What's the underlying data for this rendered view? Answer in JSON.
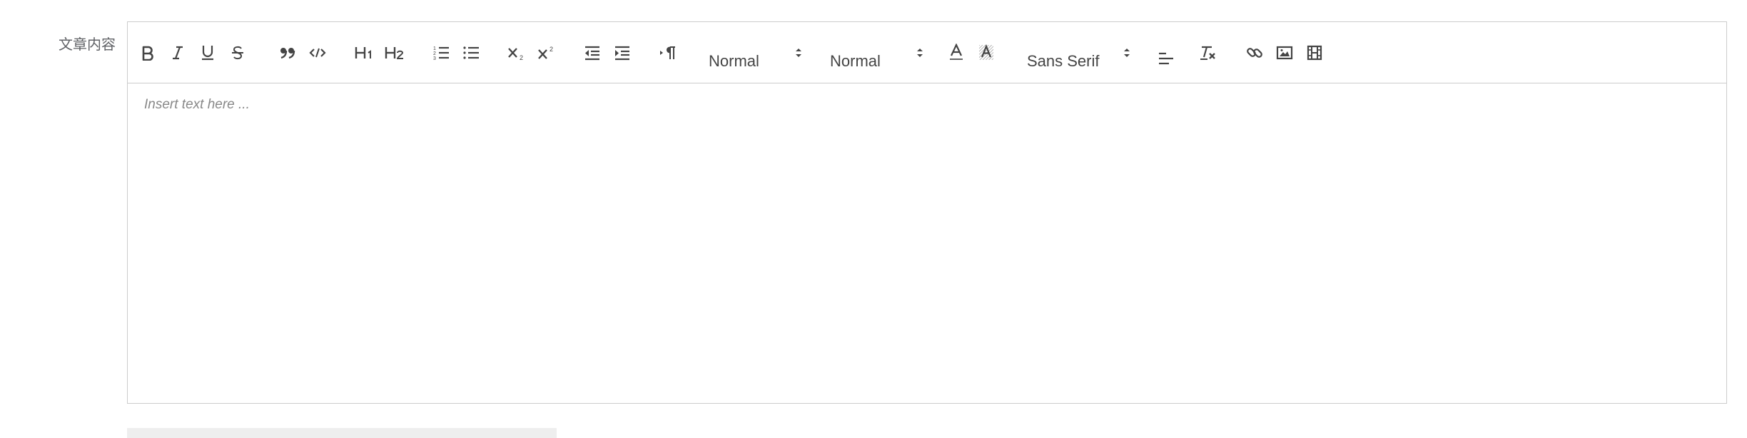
{
  "form": {
    "label": "文章内容"
  },
  "editor": {
    "placeholder": "Insert text here ...",
    "toolbar": {
      "header_picker_1": "Normal",
      "header_picker_2": "Normal",
      "font_picker": "Sans Serif"
    }
  },
  "icons": [
    "bold-icon",
    "italic-icon",
    "underline-icon",
    "strike-icon",
    "blockquote-icon",
    "code-block-icon",
    "header-1-icon",
    "header-2-icon",
    "ordered-list-icon",
    "bullet-list-icon",
    "subscript-icon",
    "superscript-icon",
    "outdent-icon",
    "indent-icon",
    "direction-icon",
    "color-icon",
    "background-icon",
    "align-icon",
    "clean-icon",
    "link-icon",
    "image-icon",
    "video-icon"
  ]
}
